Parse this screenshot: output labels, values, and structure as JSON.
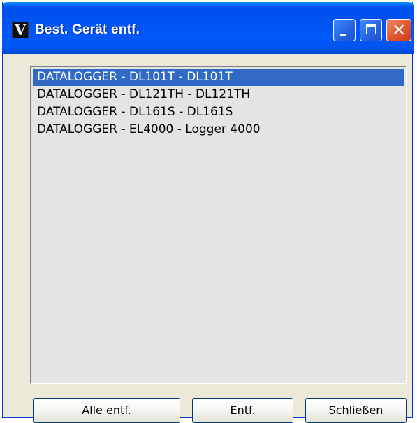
{
  "window": {
    "title": "Best. Gerät entf.",
    "app_icon_glyph": "V",
    "icons": {
      "app": "app-v-icon",
      "minimize": "minimize-icon",
      "maximize": "maximize-icon",
      "close": "close-icon"
    },
    "close_glyph": "✕"
  },
  "device_list": {
    "selected_index": 0,
    "items": [
      {
        "label": "DATALOGGER - DL101T - DL101T"
      },
      {
        "label": "DATALOGGER - DL121TH - DL121TH"
      },
      {
        "label": "DATALOGGER - DL161S - DL161S"
      },
      {
        "label": "DATALOGGER - EL4000 - Logger 4000"
      }
    ]
  },
  "buttons": {
    "remove_all": "Alle entf.",
    "remove": "Entf.",
    "close": "Schließen"
  },
  "colors": {
    "titlebar": "#0055f4",
    "selection": "#316ac5",
    "list_background": "#e4e4e4",
    "window_background": "#ece9d8",
    "close_button": "#e2552e"
  }
}
